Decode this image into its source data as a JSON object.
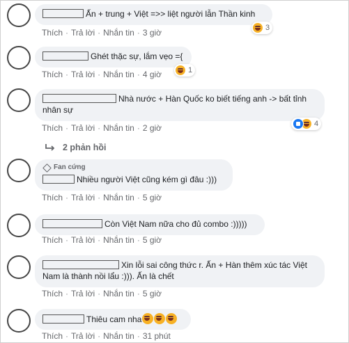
{
  "actions": {
    "like": "Thích",
    "reply": "Trả lời",
    "message": "Nhắn tin",
    "sep": "·"
  },
  "colors": {
    "bubble": "#f0f2f5",
    "meta": "#65676b",
    "like_blue": "#1877f2",
    "haha_yellow": "#f7b125"
  },
  "comments": [
    {
      "text": "Ấn + trung + Việt =>> liệt người lẫn Thần kinh",
      "time": "3 giờ",
      "reactions": {
        "icons": [
          "haha-icon"
        ],
        "count": "3"
      }
    },
    {
      "text": "Ghét thặc sự, lắm vẹo ={",
      "time": "4 giờ",
      "reactions": {
        "icons": [
          "haha-icon"
        ],
        "count": "1"
      }
    },
    {
      "text": "Nhà nước + Hàn Quốc ko biết tiếng anh -> bất tỉnh nhân sự",
      "time": "2 giờ",
      "reactions": {
        "icons": [
          "like-icon",
          "haha-icon"
        ],
        "count": "4"
      },
      "replies_label": "2 phản hồi"
    },
    {
      "badge": "Fan cứng",
      "text": "Nhiều người Việt cũng kém gì đâu :)))",
      "time": "5 giờ"
    },
    {
      "text": "Còn Việt Nam nữa cho đủ combo :)))))",
      "time": "5 giờ"
    },
    {
      "text": "Xin lỗi sai công thức r. Ấn + Hàn thêm xúc tác Việt Nam là thành nồi lẩu :))). Ấn là chết",
      "time": "5 giờ"
    },
    {
      "text": "Thiêu cam nha",
      "emoji_suffix": [
        "haha-icon",
        "haha-icon",
        "haha-icon"
      ],
      "time": "31 phút"
    }
  ]
}
